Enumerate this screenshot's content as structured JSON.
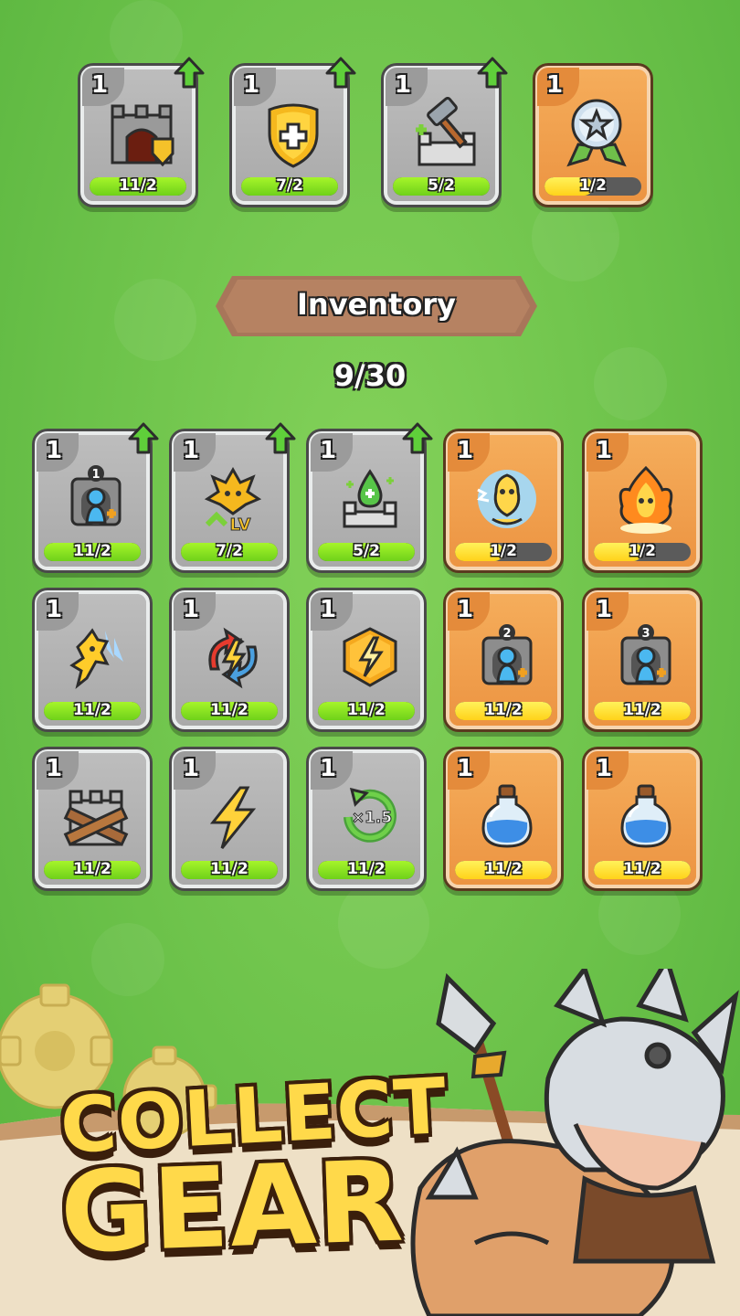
{
  "equipped": [
    {
      "level": "1",
      "progress": "11/2",
      "fill": 1.0,
      "rarity": "gray",
      "upgradable": true,
      "icon": "castle-gate-shield-icon"
    },
    {
      "level": "1",
      "progress": "7/2",
      "fill": 1.0,
      "rarity": "gray",
      "upgradable": true,
      "icon": "gold-shield-icon"
    },
    {
      "level": "1",
      "progress": "5/2",
      "fill": 1.0,
      "rarity": "gray",
      "upgradable": true,
      "icon": "hammer-wall-icon"
    },
    {
      "level": "1",
      "progress": "1/2",
      "fill": 0.5,
      "rarity": "orange",
      "upgradable": false,
      "icon": "star-medal-icon"
    }
  ],
  "inventory": {
    "title": "Inventory",
    "count": "9/30",
    "items": [
      {
        "level": "1",
        "progress": "11/2",
        "fill": 1.0,
        "rarity": "gray",
        "upgradable": true,
        "icon": "hero-slot-1-icon",
        "badge": "1"
      },
      {
        "level": "1",
        "progress": "7/2",
        "fill": 1.0,
        "rarity": "gray",
        "upgradable": true,
        "icon": "level-up-spirit-icon",
        "badge": "LV"
      },
      {
        "level": "1",
        "progress": "5/2",
        "fill": 1.0,
        "rarity": "gray",
        "upgradable": true,
        "icon": "healing-wall-icon"
      },
      {
        "level": "1",
        "progress": "1/2",
        "fill": 0.5,
        "rarity": "orange",
        "upgradable": false,
        "icon": "electric-spirit-icon"
      },
      {
        "level": "1",
        "progress": "1/2",
        "fill": 0.5,
        "rarity": "orange",
        "upgradable": false,
        "icon": "fire-spirit-icon"
      },
      {
        "level": "1",
        "progress": "11/2",
        "fill": 1.0,
        "rarity": "gray",
        "upgradable": false,
        "icon": "dashing-spirit-icon"
      },
      {
        "level": "1",
        "progress": "11/2",
        "fill": 1.0,
        "rarity": "gray",
        "upgradable": false,
        "icon": "energy-swap-icon"
      },
      {
        "level": "1",
        "progress": "11/2",
        "fill": 1.0,
        "rarity": "gray",
        "upgradable": false,
        "icon": "lightning-hex-icon"
      },
      {
        "level": "1",
        "progress": "11/2",
        "fill": 1.0,
        "rarity": "orange",
        "upgradable": false,
        "icon": "hero-slot-2-icon",
        "badge": "2"
      },
      {
        "level": "1",
        "progress": "11/2",
        "fill": 1.0,
        "rarity": "orange",
        "upgradable": false,
        "icon": "hero-slot-3-icon",
        "badge": "3"
      },
      {
        "level": "1",
        "progress": "11/2",
        "fill": 1.0,
        "rarity": "gray",
        "upgradable": false,
        "icon": "barricade-wall-icon"
      },
      {
        "level": "1",
        "progress": "11/2",
        "fill": 1.0,
        "rarity": "gray",
        "upgradable": false,
        "icon": "lightning-bolt-icon"
      },
      {
        "level": "1",
        "progress": "11/2",
        "fill": 1.0,
        "rarity": "gray",
        "upgradable": false,
        "icon": "speed-x1.5-icon",
        "badge": "×1.5"
      },
      {
        "level": "1",
        "progress": "11/2",
        "fill": 1.0,
        "rarity": "orange",
        "upgradable": false,
        "icon": "blue-potion-icon"
      },
      {
        "level": "1",
        "progress": "11/2",
        "fill": 1.0,
        "rarity": "orange",
        "upgradable": false,
        "icon": "blue-potion-icon"
      }
    ]
  },
  "promo": {
    "line1": "COLLECT",
    "line2": "GEAR"
  },
  "colors": {
    "green_bg": "#6cc24a",
    "gray_card": "#b4b4b4",
    "orange_card": "#f1a050",
    "bar_green": "#8fe21f",
    "bar_yellow": "#ffe13a",
    "banner_brown": "#a8765a"
  }
}
